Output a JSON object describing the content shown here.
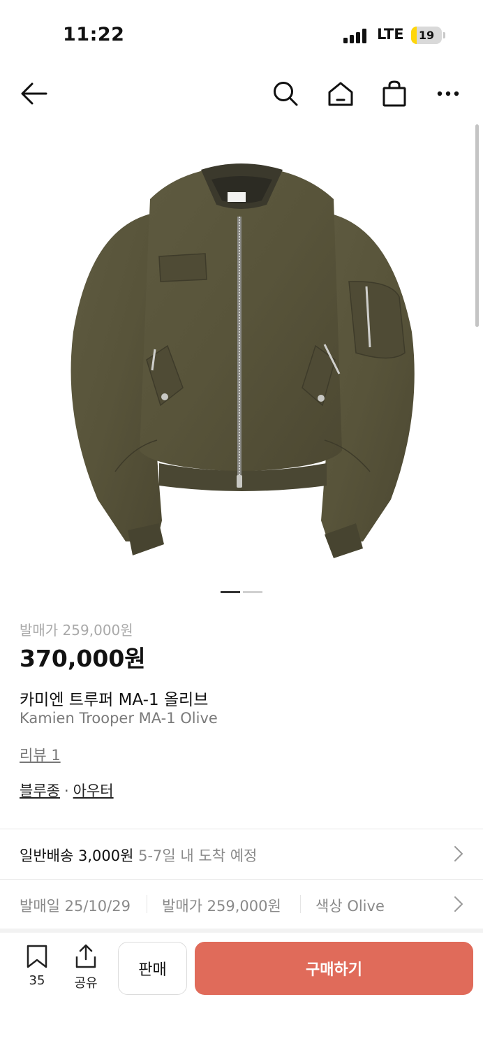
{
  "status_bar": {
    "time": "11:22",
    "network": "LTE",
    "battery": "19",
    "battery_level": 0.19,
    "battery_color": "#ffd60a"
  },
  "nav": {
    "icons": [
      "back-arrow-icon",
      "search-icon",
      "home-icon",
      "shopping-bag-icon",
      "more-icon"
    ]
  },
  "gallery": {
    "page_count": 2,
    "current_page": 1,
    "image": "olive-bomber-jacket"
  },
  "product": {
    "release_price_label": "발매가 259,000원",
    "price": "370,000원",
    "name_ko": "카미엔 트루퍼 MA-1 올리브",
    "name_en": "Kamien Trooper MA-1 Olive",
    "reviews": "리뷰 1",
    "categories": [
      "블루종",
      "아우터"
    ],
    "category_separator": "·"
  },
  "shipping": {
    "method": "일반배송 3,000원",
    "eta": "5-7일 내 도착 예정"
  },
  "meta": {
    "release_date": "발매일 25/10/29",
    "release_price": "발매가 259,000원",
    "color": "색상 Olive"
  },
  "actions": {
    "wishlist_count": "35",
    "share_label": "공유",
    "sell_label": "판매",
    "buy_label": "구매하기",
    "buy_color": "#e06b5a"
  }
}
